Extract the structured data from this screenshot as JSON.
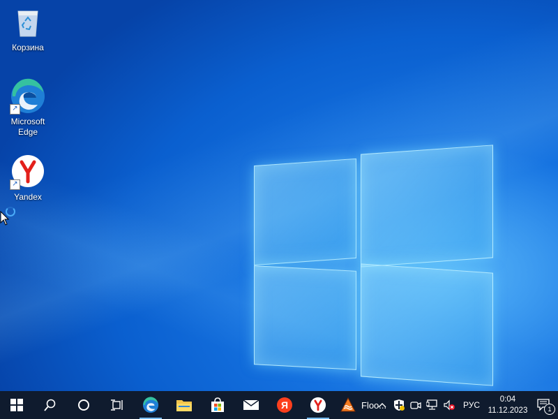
{
  "desktop": {
    "icons": [
      {
        "label": "Корзина",
        "icon": "recycle-bin-icon"
      },
      {
        "label": "Microsoft Edge",
        "icon": "edge-icon"
      },
      {
        "label": "Yandex",
        "icon": "yandex-icon"
      }
    ]
  },
  "taskbar": {
    "pinned": [
      {
        "name": "start-button",
        "icon": "windows-logo-icon"
      },
      {
        "name": "search-button",
        "icon": "search-icon"
      },
      {
        "name": "cortana-button",
        "icon": "cortana-circle-icon"
      },
      {
        "name": "task-view-button",
        "icon": "task-view-icon"
      },
      {
        "name": "edge",
        "icon": "edge-icon"
      },
      {
        "name": "file-explorer",
        "icon": "folder-icon"
      },
      {
        "name": "microsoft-store",
        "icon": "store-bag-icon"
      },
      {
        "name": "mail",
        "icon": "mail-icon"
      },
      {
        "name": "yandex-browser",
        "icon": "yandex-browser-icon"
      },
      {
        "name": "yandex",
        "icon": "yandex-icon"
      }
    ],
    "running_app": {
      "label": "Floo...",
      "icon": "flood-app-icon"
    },
    "tray": {
      "language": "РУС",
      "time": "0:04",
      "date": "11.12.2023",
      "notification_count": "1"
    }
  },
  "colors": {
    "taskbar": "#0f1b2e",
    "accent": "#76b9ed",
    "wallpaper": "#0a58c8"
  }
}
